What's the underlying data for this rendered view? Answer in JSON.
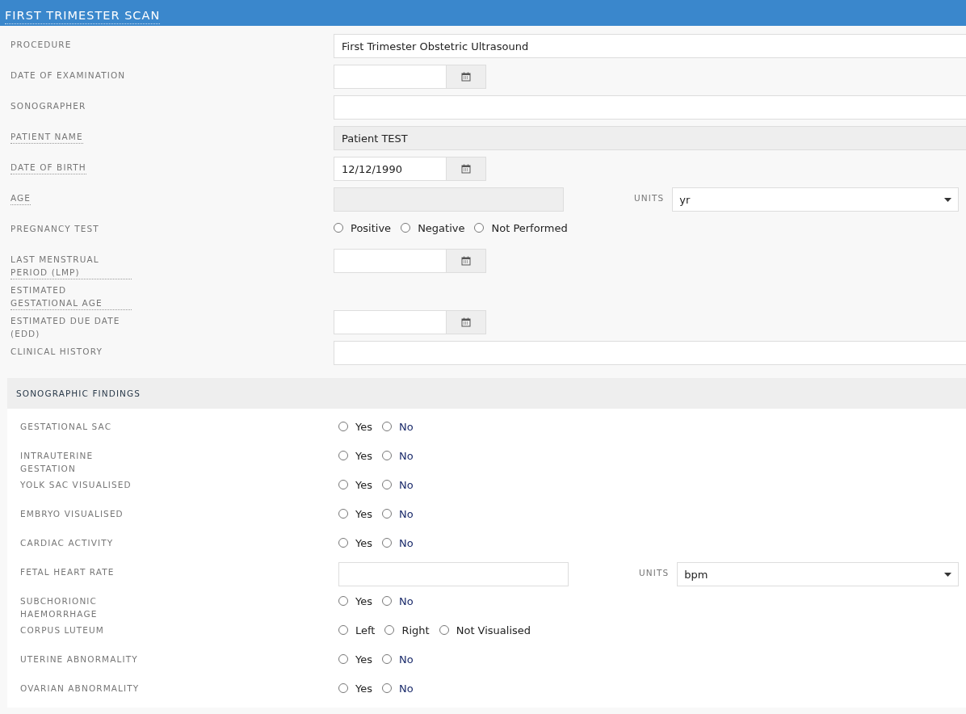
{
  "title": "FIRST TRIMESTER SCAN",
  "fields": [
    {
      "kind": "text",
      "label": "PROCEDURE",
      "help": false,
      "value": "First Trimester Obstetric Ultrasound"
    },
    {
      "kind": "date",
      "label": "DATE OF EXAMINATION",
      "help": false
    },
    {
      "kind": "text",
      "label": "SONOGRAPHER",
      "help": false
    },
    {
      "kind": "readonly",
      "label": "PATIENT NAME",
      "help": true,
      "value": "Patient TEST"
    },
    {
      "kind": "date",
      "label": "DATE OF BIRTH",
      "help": true,
      "value": "12/12/1990"
    },
    {
      "kind": "units",
      "label": "AGE",
      "help": true,
      "readonly": true,
      "units_label": "UNITS",
      "units": "yr"
    },
    {
      "kind": "radio",
      "label": "PREGNANCY TEST",
      "help": false,
      "options": [
        {
          "label": "Positive",
          "selected": false
        },
        {
          "label": "Negative",
          "selected": false
        },
        {
          "label": "Not Performed",
          "selected": false
        }
      ]
    },
    {
      "kind": "date",
      "label": "LAST MENSTRUAL PERIOD (LMP)",
      "help": true
    },
    {
      "kind": "none",
      "label": "ESTIMATED GESTATIONAL AGE",
      "help": true
    },
    {
      "kind": "date",
      "label": "ESTIMATED DUE DATE (EDD)",
      "help": false
    },
    {
      "kind": "text",
      "label": "CLINICAL HISTORY",
      "help": false
    }
  ],
  "findings": {
    "title": "SONOGRAPHIC FINDINGS",
    "rows": [
      {
        "kind": "radio",
        "label": "GESTATIONAL SAC",
        "options": [
          {
            "label": "Yes",
            "selected": false
          },
          {
            "label": "No",
            "selected": false
          }
        ]
      },
      {
        "kind": "radio",
        "label": "INTRAUTERINE GESTATION",
        "options": [
          {
            "label": "Yes",
            "selected": false
          },
          {
            "label": "No",
            "selected": false
          }
        ]
      },
      {
        "kind": "radio",
        "label": "YOLK SAC VISUALISED",
        "options": [
          {
            "label": "Yes",
            "selected": false
          },
          {
            "label": "No",
            "selected": false
          }
        ]
      },
      {
        "kind": "radio",
        "label": "EMBRYO VISUALISED",
        "options": [
          {
            "label": "Yes",
            "selected": false
          },
          {
            "label": "No",
            "selected": false
          }
        ]
      },
      {
        "kind": "radio",
        "label": "CARDIAC ACTIVITY",
        "options": [
          {
            "label": "Yes",
            "selected": false
          },
          {
            "label": "No",
            "selected": false
          }
        ]
      },
      {
        "kind": "units",
        "label": "FETAL HEART RATE",
        "readonly": false,
        "units_label": "UNITS",
        "units": "bpm"
      },
      {
        "kind": "radio",
        "label": "SUBCHORIONIC HAEMORRHAGE",
        "options": [
          {
            "label": "Yes",
            "selected": false
          },
          {
            "label": "No",
            "selected": false
          }
        ]
      },
      {
        "kind": "radio",
        "label": "CORPUS LUTEUM",
        "options": [
          {
            "label": "Left",
            "selected": false
          },
          {
            "label": "Right",
            "selected": false
          },
          {
            "label": "Not Visualised",
            "selected": false
          }
        ]
      },
      {
        "kind": "radio",
        "label": "UTERINE ABNORMALITY",
        "options": [
          {
            "label": "Yes",
            "selected": false
          },
          {
            "label": "No",
            "selected": false
          }
        ]
      },
      {
        "kind": "radio",
        "label": "OVARIAN ABNORMALITY",
        "options": [
          {
            "label": "Yes",
            "selected": false
          },
          {
            "label": "No",
            "selected": false
          }
        ]
      }
    ]
  }
}
